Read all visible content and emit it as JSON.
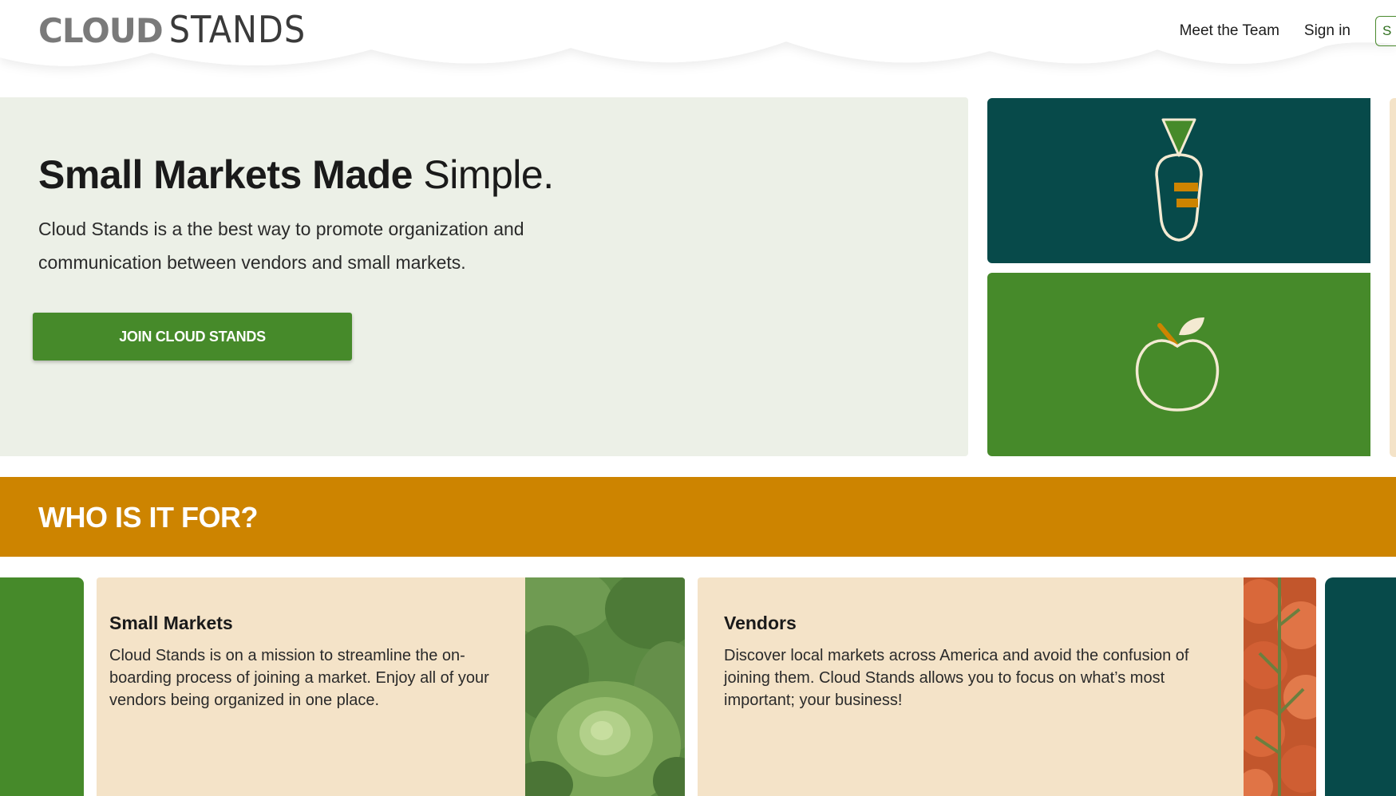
{
  "header": {
    "logo_bold": "CLOUD",
    "logo_light": "STANDS",
    "nav": {
      "meet_team": "Meet the Team",
      "sign_in": "Sign in",
      "signup_partial": "S"
    }
  },
  "hero": {
    "title_strong": "Small Markets Made",
    "title_light": "Simple.",
    "description": "Cloud Stands is a the best way to promote organization and communication between vendors and small markets.",
    "cta_label": "JOIN CLOUD STANDS",
    "tiles": [
      {
        "icon": "carrot-icon",
        "color": "#074a4a"
      },
      {
        "icon": "apple-icon",
        "color": "#468a2a"
      }
    ]
  },
  "section": {
    "title": "WHO IS IT FOR?",
    "cards": [
      {
        "title": "Small Markets",
        "text": "Cloud Stands is on a mission to streamline the on-boarding process of joining a market. Enjoy all of your vendors being organized in one place.",
        "image": "lettuce-photo"
      },
      {
        "title": "Vendors",
        "text": "Discover local markets across America and avoid the confusion of joining them. Cloud Stands allows you to focus on what’s most important; your business!",
        "image": "tomatoes-photo"
      }
    ]
  },
  "colors": {
    "dark_teal": "#074a4a",
    "green": "#468a2a",
    "orange": "#cd8400",
    "cream": "#f4e3c8",
    "hero_bg": "#ecf0e7"
  }
}
